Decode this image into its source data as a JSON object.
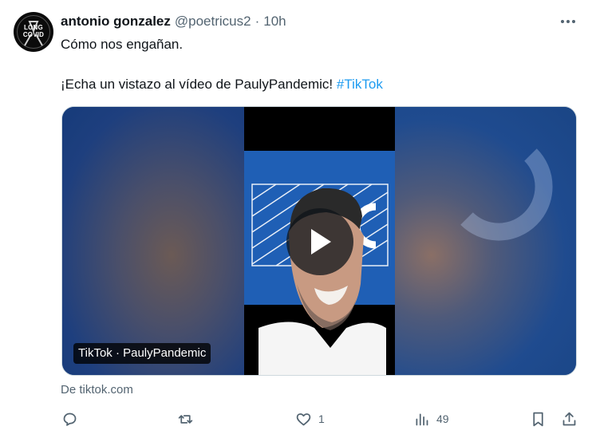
{
  "author": {
    "name": "antonio gonzalez",
    "handle": "@poetricus2",
    "separator": "·",
    "time": "10h",
    "avatar_text_top": "LONG",
    "avatar_text_bottom": "COVID"
  },
  "tweet": {
    "line1": "Cómo nos engañan.",
    "line2_prefix": "¡Echa un vistazo al vídeo de PaulyPandemic! ",
    "hashtag": "#TikTok"
  },
  "media": {
    "badge": "TikTok · PaulyPandemic",
    "play_icon": "play-icon"
  },
  "card_source": "De tiktok.com",
  "actions": {
    "reply_count": "",
    "retweet_count": "",
    "like_count": "1",
    "views_count": "49"
  },
  "colors": {
    "text": "#0f1419",
    "secondary": "#536471",
    "link": "#1d9bf0",
    "media_blue": "#1f5fb5"
  }
}
